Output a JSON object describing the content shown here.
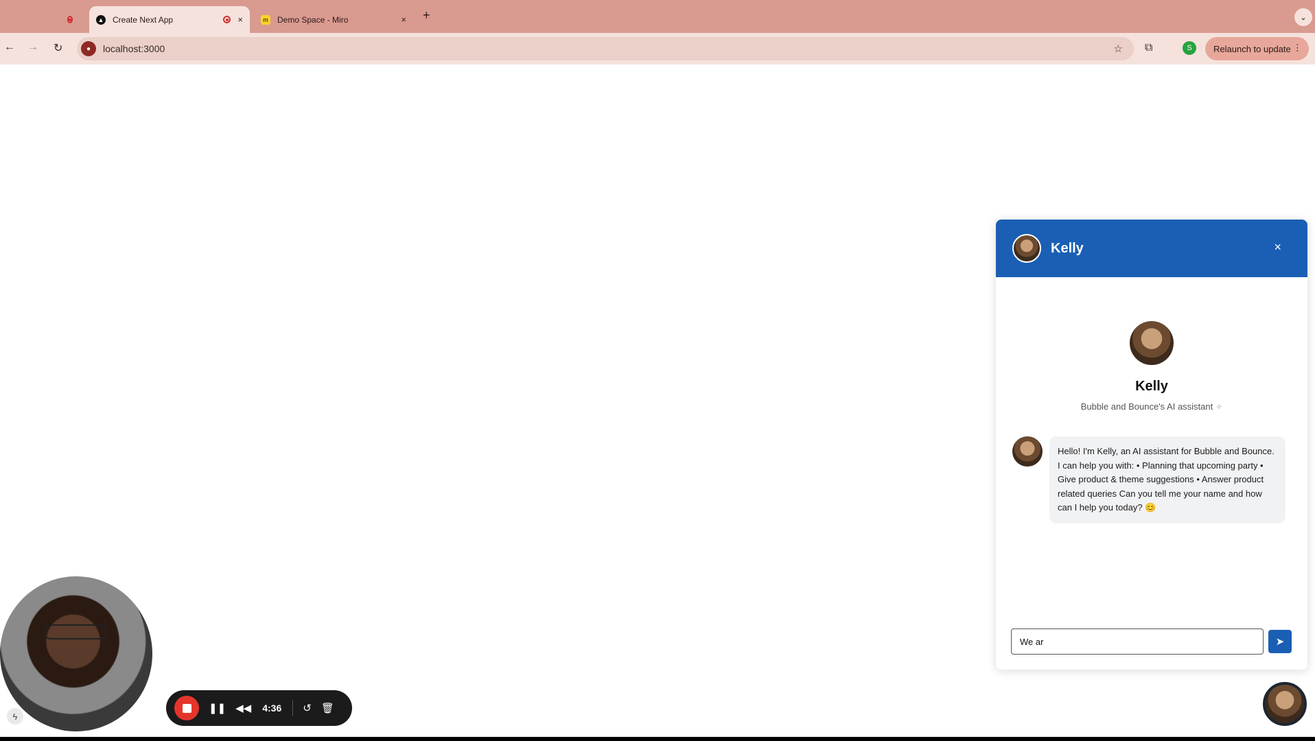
{
  "browser": {
    "tabs": [
      {
        "title": "Create Next App",
        "close": "×"
      },
      {
        "title": "Demo Space - Miro",
        "close": "×"
      }
    ],
    "new_tab": "+",
    "url": "localhost:3000",
    "relaunch_label": "Relaunch to update",
    "profile_initial": "S"
  },
  "chat": {
    "header_name": "Kelly",
    "close": "×",
    "profile_name": "Kelly",
    "profile_subtitle": "Bubble and Bounce's AI assistant",
    "messages": [
      {
        "text": "Hello! I'm Kelly, an AI assistant for Bubble and Bounce. I can help you with: • Planning that upcoming party • Give product & theme suggestions • Answer product related queries Can you tell me your name and how can I help you today? 😊"
      }
    ],
    "input_value": "We ar"
  },
  "recorder": {
    "time": "4:36"
  },
  "colors": {
    "chat_accent": "#1a5fb4",
    "tabstrip": "#d99a90",
    "record_red": "#e5352b"
  }
}
